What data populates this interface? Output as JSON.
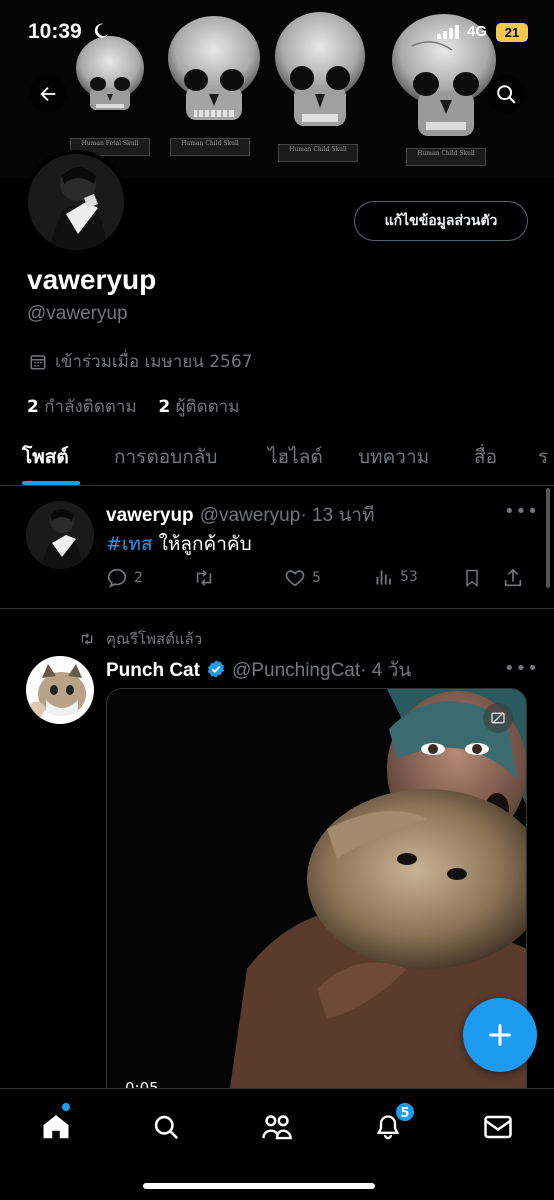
{
  "status_bar": {
    "time": "10:39",
    "network": "4G",
    "battery": "21"
  },
  "banner": {
    "plates": [
      "Human Fetal Skull",
      "Human Child Skull",
      "Human Child Skull",
      "Human Child Skull"
    ]
  },
  "profile": {
    "edit_button": "แก้ไขข้อมูลส่วนตัว",
    "name": "vaweryup",
    "handle": "@vaweryup",
    "joined": "เข้าร่วมเมื่อ เมษายน 2567",
    "following_count": "2",
    "following_label": "กำลังติดตาม",
    "followers_count": "2",
    "followers_label": "ผู้ติดตาม"
  },
  "tabs": [
    "โพสต์",
    "การตอบกลับ",
    "ไฮไลต์",
    "บทความ",
    "สื่อ",
    "ร"
  ],
  "posts": [
    {
      "name": "vaweryup",
      "handle": "@vaweryup",
      "time": "· 13 นาที",
      "hashtag": "#เทส",
      "text": " ให้ลูกค้าคับ",
      "replies": "2",
      "likes": "5",
      "views": "53"
    },
    {
      "repost_label": "คุณรีโพสต์แล้ว",
      "name": "Punch Cat",
      "handle": "@PunchingCat",
      "time": "· 4 วัน",
      "video_time": "0:05"
    }
  ],
  "nav": {
    "notifications_badge": "5"
  },
  "colors": {
    "accent": "#1d9bf0",
    "background": "#000000",
    "muted": "#71767b",
    "divider": "#2f3336"
  }
}
